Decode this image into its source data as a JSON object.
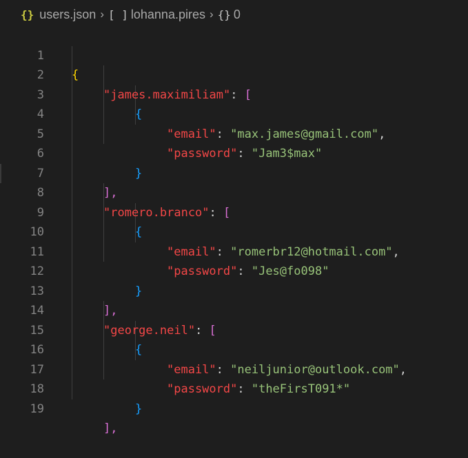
{
  "breadcrumb": {
    "file_icon": "{}",
    "file": "users.json",
    "seg1_icon": "[ ]",
    "seg1": "lohanna.pires",
    "seg2_icon": "{}",
    "seg2": "0"
  },
  "editor": {
    "lines": [
      {
        "n": "1"
      },
      {
        "n": "2",
        "key": "\"james.maximiliam\""
      },
      {
        "n": "3"
      },
      {
        "n": "4",
        "key": "\"email\"",
        "val": "\"max.james@gmail.com\""
      },
      {
        "n": "5",
        "key": "\"password\"",
        "val": "\"Jam3$max\""
      },
      {
        "n": "6"
      },
      {
        "n": "7"
      },
      {
        "n": "8",
        "key": "\"romero.branco\""
      },
      {
        "n": "9"
      },
      {
        "n": "10",
        "key": "\"email\"",
        "val": "\"romerbr12@hotmail.com\""
      },
      {
        "n": "11",
        "key": "\"password\"",
        "val": "\"Jes@fo098\""
      },
      {
        "n": "12"
      },
      {
        "n": "13"
      },
      {
        "n": "14",
        "key": "\"george.neil\""
      },
      {
        "n": "15"
      },
      {
        "n": "16",
        "key": "\"email\"",
        "val": "\"neiljunior@outlook.com\""
      },
      {
        "n": "17",
        "key": "\"password\"",
        "val": "\"theFirsT091*\""
      },
      {
        "n": "18"
      },
      {
        "n": "19"
      }
    ],
    "tokens": {
      "open_brace": "{",
      "close_brace": "}",
      "open_bracket": "[",
      "close_bracket": "],",
      "colon": ": ",
      "comma": ","
    }
  },
  "colors": {
    "background": "#1e1e1e",
    "key": "#f44747",
    "string": "#98c379",
    "bracket_level1": "#ffd700",
    "bracket_level2": "#da70d6",
    "bracket_level3": "#179fff",
    "line_number": "#858585"
  }
}
